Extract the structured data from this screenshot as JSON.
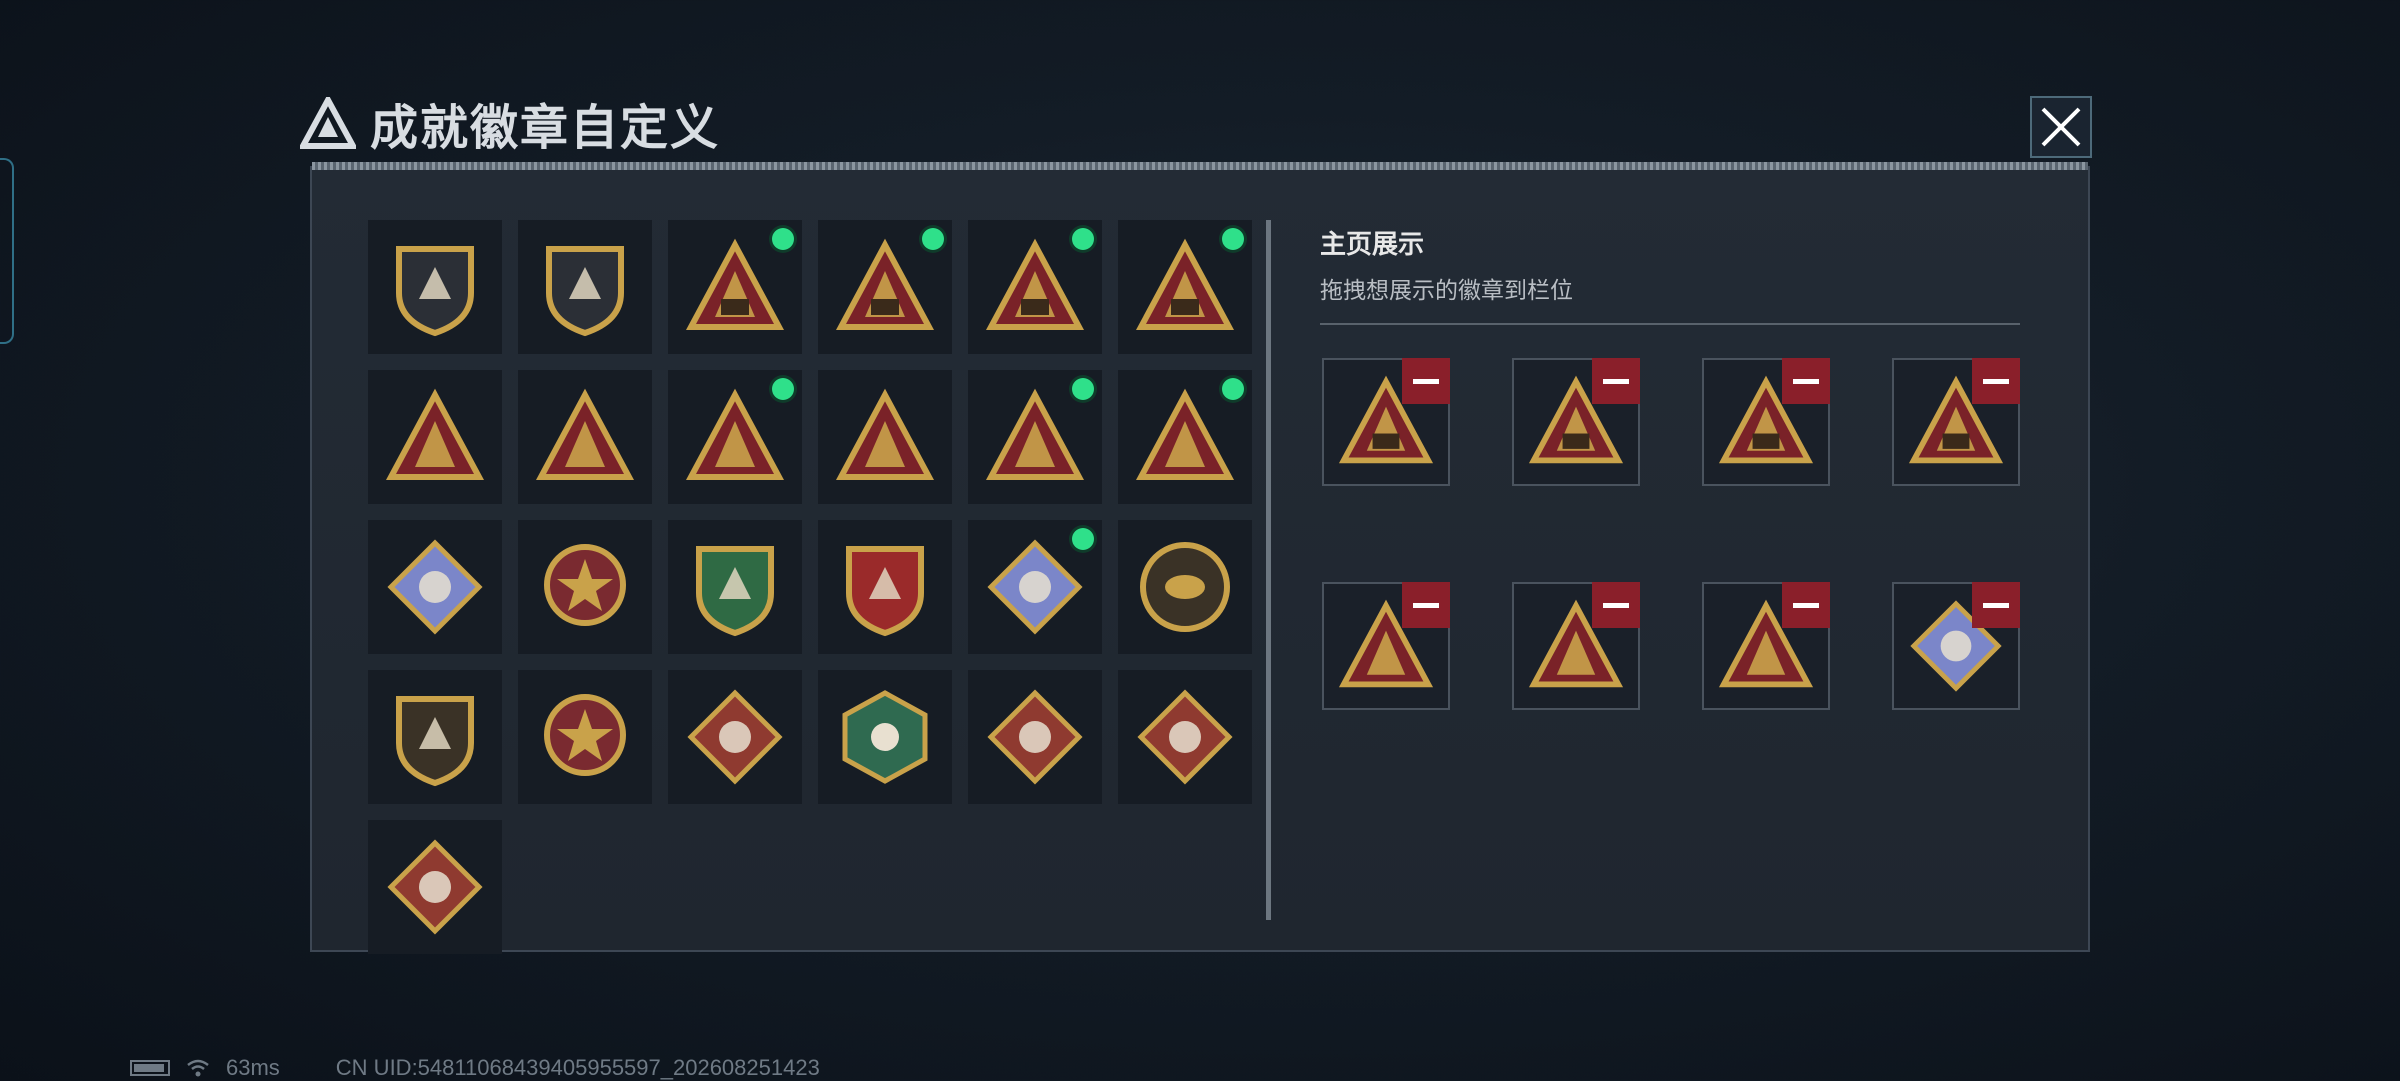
{
  "title": "成就徽章自定义",
  "right_panel": {
    "title": "主页展示",
    "subtitle": "拖拽想展示的徽章到栏位"
  },
  "badges": [
    {
      "icon": "triangle-shield-badge",
      "new": false
    },
    {
      "icon": "helicopter-shield-badge",
      "new": false
    },
    {
      "icon": "s6-triangle-badge",
      "new": true
    },
    {
      "icon": "s7-triangle-badge",
      "new": true
    },
    {
      "icon": "s8-triangle-badge",
      "new": true
    },
    {
      "icon": "s9-triangle-badge",
      "new": true
    },
    {
      "icon": "boat-triangle-badge",
      "new": false
    },
    {
      "icon": "number-one-triangle-badge",
      "new": false
    },
    {
      "icon": "usb-triangle-badge",
      "new": true
    },
    {
      "icon": "runner-triangle-badge",
      "new": false
    },
    {
      "icon": "soldiers-triangle-badge",
      "new": true
    },
    {
      "icon": "rocket-triangle-badge",
      "new": true
    },
    {
      "icon": "blue-diamond-badge",
      "new": false
    },
    {
      "icon": "star-medal-badge",
      "new": false
    },
    {
      "icon": "green-shield-badge",
      "new": false
    },
    {
      "icon": "gold-shield-badge",
      "new": false
    },
    {
      "icon": "blue-diamond-shield-badge",
      "new": true
    },
    {
      "icon": "eye-coin-badge",
      "new": false
    },
    {
      "icon": "rifle-shield-badge",
      "new": false
    },
    {
      "icon": "crossed-blades-badge",
      "new": false
    },
    {
      "icon": "wolf-diamond-badge",
      "new": false
    },
    {
      "icon": "dragon-hexagon-badge",
      "new": false
    },
    {
      "icon": "red-dragon-diamond-badge",
      "new": false
    },
    {
      "icon": "runner-diamond-badge",
      "new": false
    },
    {
      "icon": "rose-diamond-badge",
      "new": false
    }
  ],
  "slots": [
    {
      "icon": "s9-triangle-badge"
    },
    {
      "icon": "s8-triangle-badge"
    },
    {
      "icon": "s7-triangle-badge"
    },
    {
      "icon": "s6-triangle-badge"
    },
    {
      "icon": "soldiers-triangle-badge"
    },
    {
      "icon": "usb-triangle-badge"
    },
    {
      "icon": "rocket-triangle-badge"
    },
    {
      "icon": "blue-diamond-shield-badge"
    }
  ],
  "footer": {
    "ping": "63ms",
    "uid": "CN UID:54811068439405955597_202608251423"
  },
  "colors": {
    "accent_green": "#2fe08a",
    "remove_red": "#8a1f2a",
    "badge_gold": "#c9a24a",
    "badge_red": "#7a2228"
  }
}
